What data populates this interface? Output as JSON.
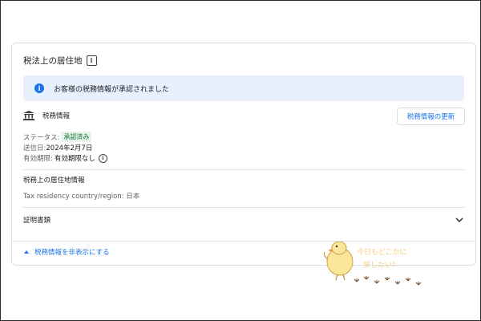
{
  "card": {
    "title": "税法上の居住地",
    "title_icon": "info-square-icon",
    "banner": {
      "icon": "info-icon",
      "text": "お客様の税務情報が承認されました",
      "color": "#e8f0fe",
      "accent": "#1a73e8"
    },
    "tax_info": {
      "icon": "bank-icon",
      "label": "税務情報",
      "update_button": "税務情報の更新"
    },
    "details": {
      "status_label": "ステータス:",
      "status_value": "承認済み",
      "sent_label": "送信日:",
      "sent_value": "2024年2月7日",
      "expiry_label": "有効期限:",
      "expiry_value": "有効期限なし",
      "expiry_icon": "info-circle-icon"
    },
    "residency": {
      "title": "税務上の居住地情報",
      "line": "Tax residency country/region: 日本"
    },
    "certificates": {
      "label": "証明書類",
      "icon": "chevron-down-icon"
    },
    "hide_link": {
      "label": "税務情報を非表示にする",
      "icon": "caret-up-icon"
    }
  },
  "watermark": {
    "icon": "chick-mascot-icon",
    "text_line1": "今日もどこかに",
    "text_line2": "旅したい！"
  }
}
